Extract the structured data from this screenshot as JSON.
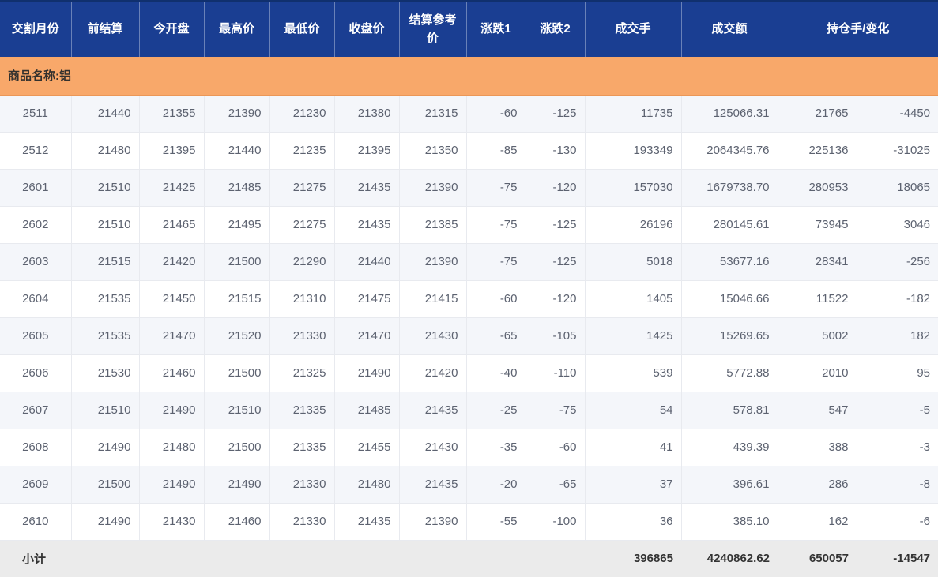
{
  "table": {
    "headers": [
      "交割月份",
      "前结算",
      "今开盘",
      "最高价",
      "最低价",
      "收盘价",
      "结算参考价",
      "涨跌1",
      "涨跌2",
      "成交手",
      "成交额",
      "持仓手/变化"
    ],
    "group_row": {
      "label": "商品名称:铝"
    },
    "rows": [
      [
        "2511",
        "21440",
        "21355",
        "21390",
        "21230",
        "21380",
        "21315",
        "-60",
        "-125",
        "11735",
        "125066.31",
        "21765",
        "-4450"
      ],
      [
        "2512",
        "21480",
        "21395",
        "21440",
        "21235",
        "21395",
        "21350",
        "-85",
        "-130",
        "193349",
        "2064345.76",
        "225136",
        "-31025"
      ],
      [
        "2601",
        "21510",
        "21425",
        "21485",
        "21275",
        "21435",
        "21390",
        "-75",
        "-120",
        "157030",
        "1679738.70",
        "280953",
        "18065"
      ],
      [
        "2602",
        "21510",
        "21465",
        "21495",
        "21275",
        "21435",
        "21385",
        "-75",
        "-125",
        "26196",
        "280145.61",
        "73945",
        "3046"
      ],
      [
        "2603",
        "21515",
        "21420",
        "21500",
        "21290",
        "21440",
        "21390",
        "-75",
        "-125",
        "5018",
        "53677.16",
        "28341",
        "-256"
      ],
      [
        "2604",
        "21535",
        "21450",
        "21515",
        "21310",
        "21475",
        "21415",
        "-60",
        "-120",
        "1405",
        "15046.66",
        "11522",
        "-182"
      ],
      [
        "2605",
        "21535",
        "21470",
        "21520",
        "21330",
        "21470",
        "21430",
        "-65",
        "-105",
        "1425",
        "15269.65",
        "5002",
        "182"
      ],
      [
        "2606",
        "21530",
        "21460",
        "21500",
        "21325",
        "21490",
        "21420",
        "-40",
        "-110",
        "539",
        "5772.88",
        "2010",
        "95"
      ],
      [
        "2607",
        "21510",
        "21490",
        "21510",
        "21335",
        "21485",
        "21435",
        "-25",
        "-75",
        "54",
        "578.81",
        "547",
        "-5"
      ],
      [
        "2608",
        "21490",
        "21480",
        "21500",
        "21335",
        "21455",
        "21430",
        "-35",
        "-60",
        "41",
        "439.39",
        "388",
        "-3"
      ],
      [
        "2609",
        "21500",
        "21490",
        "21490",
        "21330",
        "21480",
        "21435",
        "-20",
        "-65",
        "37",
        "396.61",
        "286",
        "-8"
      ],
      [
        "2610",
        "21490",
        "21430",
        "21460",
        "21330",
        "21435",
        "21390",
        "-55",
        "-100",
        "36",
        "385.10",
        "162",
        "-6"
      ]
    ],
    "footer": {
      "label": "小计",
      "volume": "396865",
      "turnover": "4240862.62",
      "open_interest": "650057",
      "change": "-14547"
    }
  },
  "colors": {
    "header_bg": "#1a3e92",
    "header_fg": "#ffffff",
    "group_bg": "#f8a86a",
    "group_fg": "#33312e",
    "alt_row_bg": "#f4f6fa",
    "row_bg": "#ffffff",
    "footer_bg": "#ebebeb",
    "data_fg": "#5c6270",
    "footer_fg": "#333333",
    "grid_line": "#e8eaef"
  }
}
